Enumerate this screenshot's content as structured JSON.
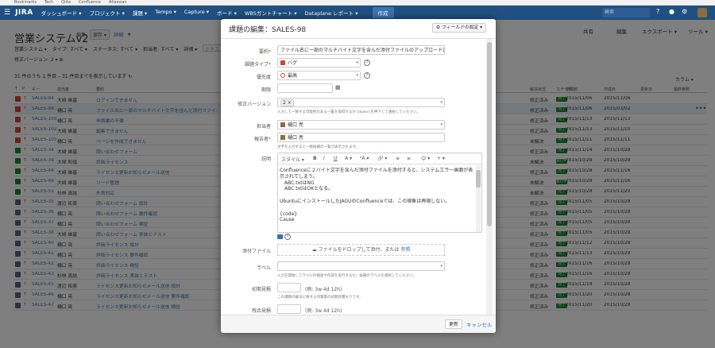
{
  "bookmarks": [
    "Bookmarks",
    "Tech",
    "Qiita",
    "Confluence",
    "Atlassian"
  ],
  "topnav": {
    "logo": "JIRA",
    "items": [
      "ダッシュボード ▾",
      "プロジェクト ▾",
      "課題 ▾",
      "Tempo ▾",
      "Capture ▾",
      "ボード ▾",
      "WBSガントチャート ▾",
      "Dataplane レポート ▾"
    ],
    "create": "作成",
    "search_placeholder": "検索"
  },
  "page": {
    "title": "営業システムv2",
    "meta": {
      "edit": "編集",
      "save": "保存 ▾",
      "details": "詳細",
      "star": "★"
    },
    "actions": {
      "share": "共有",
      "export": "エクスポート ▾",
      "edit": "編集",
      "tools": "ツール ▾"
    },
    "filters": [
      "営業システム ▾",
      "タイプ: すべて ▾",
      "ステータス: すべて ▾",
      "担当者: すべて ▾",
      "詳細 ▾"
    ],
    "filter_placeholder": "テキストを含む",
    "subfilter": "修正バージョン: 2 ▾ ⊗",
    "count_text": "31 件のうち 1 件目 – 31 件目までを表示しています ↻",
    "columns_btn": "カラム ▾",
    "headers": [
      "T",
      "P",
      "キー",
      "担当者",
      "要約",
      "解決状況",
      "ステータス",
      "期限日",
      "作成日",
      "更新日",
      "最終参照"
    ],
    "rows": [
      {
        "k": "SALES-94",
        "a": "大崎 雄基",
        "s": "ログインできません",
        "r": "修正済み",
        "st": "完了",
        "d1": "2015/11/06",
        "d2": "2015/11/06",
        "i": "red"
      },
      {
        "k": "SALES-98",
        "a": "樋口 亮",
        "s": "ファイル名に一部のマルチバイト文字を含んだ添付ファイルの…",
        "r": "修正済み",
        "st": "完了",
        "d1": "2015/11/06",
        "d2": "2015/03/02",
        "i": "red",
        "sel": true
      },
      {
        "k": "SALES-100",
        "a": "樋口 亮",
        "s": "申請書の不備",
        "r": "修正済み",
        "st": "完了",
        "d1": "2015/11/13",
        "d2": "2015/11/13",
        "i": "red"
      },
      {
        "k": "SALES-102",
        "a": "大崎 雄基",
        "s": "編集できません",
        "r": "修正済み",
        "st": "完了",
        "d1": "2015/11/13",
        "d2": "2015/11/10",
        "i": "red"
      },
      {
        "k": "SALES-105",
        "a": "樋口 亮",
        "s": "ページを作成できません",
        "r": "未解決",
        "st": "完了",
        "d1": "2015/11/11",
        "d2": "2015/11/11",
        "i": "red"
      },
      {
        "k": "SALES-34",
        "a": "大崎 雄基",
        "s": "問い合わせフォーム",
        "r": "修正済み",
        "st": "完了",
        "d1": "2015/11/14",
        "d2": "2015/10/28",
        "i": "green"
      },
      {
        "k": "SALES-39",
        "a": "大塚 和徳",
        "s": "評価ライセンス",
        "r": "未解決",
        "st": "進行中",
        "d1": "2015/10/28",
        "d2": "2015/10/28",
        "i": "green"
      },
      {
        "k": "SALES-44",
        "a": "大崎 雄基",
        "s": "ライセンス更新お知らせメール送信",
        "r": "修正済み",
        "st": "完了",
        "d1": "2015/10/28",
        "d2": "2015/11/16",
        "i": "green"
      },
      {
        "k": "SALES-49",
        "a": "大崎 雄基",
        "s": "リード管理",
        "r": "未解決",
        "st": "進行中",
        "d1": "2015/10/28",
        "d2": "2015/11/16",
        "i": "green"
      },
      {
        "k": "SALES-55",
        "a": "杉林 真結",
        "s": "外貨対応",
        "r": "未解決",
        "st": "完了",
        "d1": "2015/10/28",
        "d2": "2015/11/20",
        "i": "green"
      },
      {
        "k": "SALES-35",
        "a": "渡辺 拓美",
        "s": "問い合わせフォーム 設計",
        "r": "修正済み",
        "st": "完了",
        "d1": "2015/11/05",
        "d2": "2015/10/28",
        "i": "blue"
      },
      {
        "k": "SALES-36",
        "a": "樋口 亮",
        "s": "問い合わせフォーム 要件確認",
        "r": "修正済み",
        "st": "完了",
        "d1": "2015/11/05",
        "d2": "2015/10/28",
        "i": "blue"
      },
      {
        "k": "SALES-37",
        "a": "樋口 亮",
        "s": "問い合わせフォーム 検証",
        "r": "修正済み",
        "st": "完了",
        "d1": "2015/11/05",
        "d2": "2015/10/28",
        "i": "blue"
      },
      {
        "k": "SALES-38",
        "a": "大崎 雄基",
        "s": "問い合わせフォーム 実装とテスト",
        "r": "修正済み",
        "st": "完了",
        "d1": "2015/11/05",
        "d2": "2015/10/28",
        "i": "blue"
      },
      {
        "k": "SALES-40",
        "a": "樋口 亮",
        "s": "評価ライセンス 設計",
        "r": "修正済み",
        "st": "完了",
        "d1": "2015/11/12",
        "d2": "2015/10/28",
        "i": "blue"
      },
      {
        "k": "SALES-41",
        "a": "樋口 亮",
        "s": "評価ライセンス 要件確認",
        "r": "修正済み",
        "st": "完了",
        "d1": "2015/11/13",
        "d2": "2015/10/28",
        "i": "blue"
      },
      {
        "k": "SALES-42",
        "a": "樋口 亮",
        "s": "評価ライセンス 検証",
        "r": "修正済み",
        "st": "完了",
        "d1": "2015/11/16",
        "d2": "2015/10/28",
        "i": "blue"
      },
      {
        "k": "SALES-43",
        "a": "杉林 真結",
        "s": "評価ライセンス 実装とテスト",
        "r": "修正済み",
        "st": "完了",
        "d1": "2015/11/16",
        "d2": "2015/10/28",
        "i": "blue"
      },
      {
        "k": "SALES-45",
        "a": "渡辺 拓美",
        "s": "ライセンス更新お知らせメール送信 設計",
        "r": "修正済み",
        "st": "完了",
        "d1": "2015/11/19",
        "d2": "2015/10/28",
        "i": "blue"
      },
      {
        "k": "SALES-46",
        "a": "樋口 亮",
        "s": "ライセンス更新お知らせメール送信 要件確認",
        "r": "修正済み",
        "st": "完了",
        "d1": "2015/11/20",
        "d2": "2015/10/28",
        "i": "blue"
      },
      {
        "k": "SALES-47",
        "a": "樋口 亮",
        "s": "ライセンス更新お知らせメール送信 検証",
        "r": "修正済み",
        "st": "完了",
        "d1": "2015/11/20",
        "d2": "2015/10/28",
        "i": "blue"
      }
    ]
  },
  "dialog": {
    "title": "課題の編集：SALES-98",
    "configure": "⚙ フィールドの設定 ▾",
    "labels": {
      "summary": "要約",
      "issuetype": "課題タイプ",
      "priority": "優先度",
      "duedate": "期限",
      "fixversion": "修正バージョン",
      "assignee": "担当者",
      "reporter": "報告者",
      "description": "説明",
      "attachment": "添付ファイル",
      "labels": "ラベル",
      "estimate": "初期見積",
      "remaining": "残余見積"
    },
    "summary_value": "ファイル名に一部のマルチバイト文字を含んだ添付ファイルのアップロードに失敗する",
    "issuetype_value": "バグ",
    "priority_value": "最高",
    "fixversion_tag": "2 ×",
    "fixversion_hint": "入力して一致する可能性のある一覧を取得するか [down] を押下して選択してください。",
    "assignee_value": "樋口 亮",
    "reporter_value": "樋口 亮",
    "reporter_hint": "文字を入力すると一致候補の一覧が表示されます。",
    "toolbar": {
      "style": "スタイル ▾",
      "bold": "B",
      "italic": "I",
      "underline": "U",
      "color": "A ▾",
      "more": "ᵃA ▾",
      "link": "🔗 ▾",
      "ul": "≡",
      "ol": "≡",
      "emoji": "☺ ▾",
      "plus": "+ ▾"
    },
    "description_lines": [
      "Confluenceに２バイト文字を含んだ添付ファイルを添付すると、システムエラー画面が表示されてしまう。",
      "ABC.txtはNG",
      "ABC.txtはOKとなる。",
      "",
      "UbuntuにインストールしたJAGUのConfluenceでは、この現象は再現しない。",
      "",
      "{code}",
      "Cause"
    ],
    "drop_text": "ファイルをドロップして添付、または",
    "drop_link": "参照",
    "labels_hint": "入力を開始してラベルの検索や作成を実行するか、候補のラベルを選択してください。",
    "estimate_example": "(例: 3w 4d 12h)",
    "estimate_hint": "この課題の解決に要する作業量の初期見積もりです。",
    "remaining_example": "(例: 3w 4d 12h)",
    "update": "更新",
    "cancel": "キャンセル"
  },
  "colors": {
    "nav": "#205081",
    "link": "#3b73af",
    "done": "#14892c",
    "bug": "#d04437",
    "story": "#14892c",
    "subtask": "#4a6785"
  }
}
